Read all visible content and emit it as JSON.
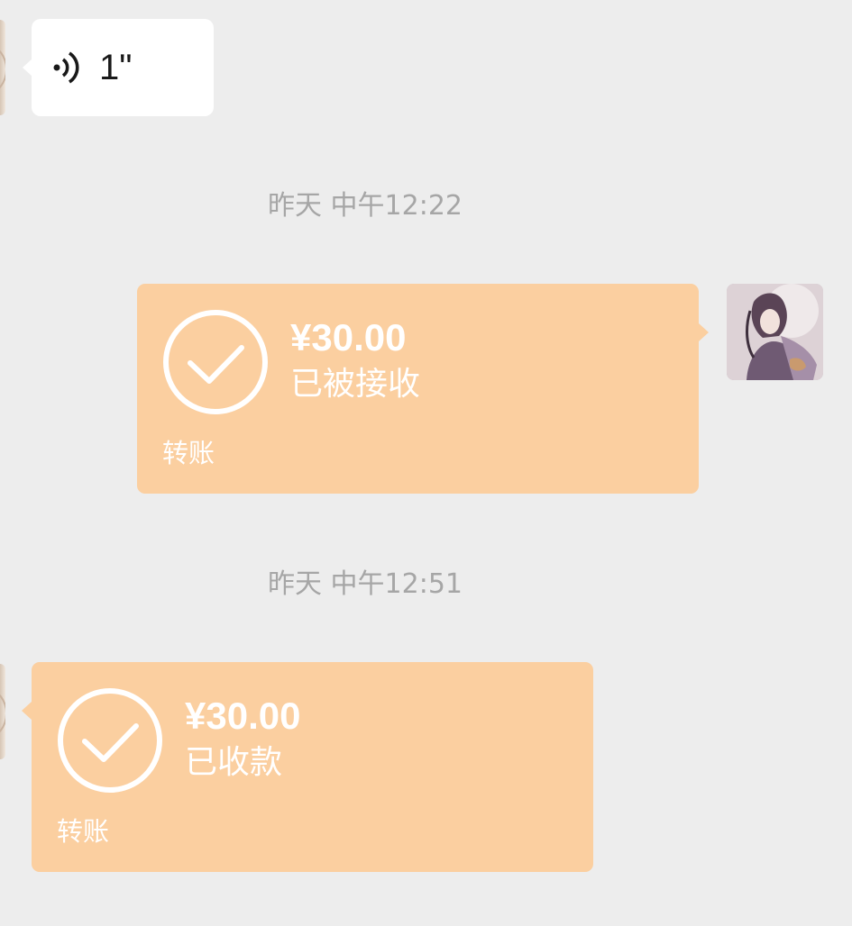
{
  "voice_message": {
    "duration": "1\""
  },
  "timestamps": [
    "昨天 中午12:22",
    "昨天 中午12:51"
  ],
  "transfers": [
    {
      "direction": "sent",
      "amount": "¥30.00",
      "status": "已被接收",
      "label": "转账",
      "icon": "check-circle-icon"
    },
    {
      "direction": "received",
      "amount": "¥30.00",
      "status": "已收款",
      "label": "转账",
      "icon": "check-circle-icon"
    }
  ],
  "colors": {
    "background": "#ededed",
    "transfer_bubble": "#fbcfa0",
    "voice_bubble": "#ffffff",
    "timestamp_text": "#a6a6a6"
  }
}
